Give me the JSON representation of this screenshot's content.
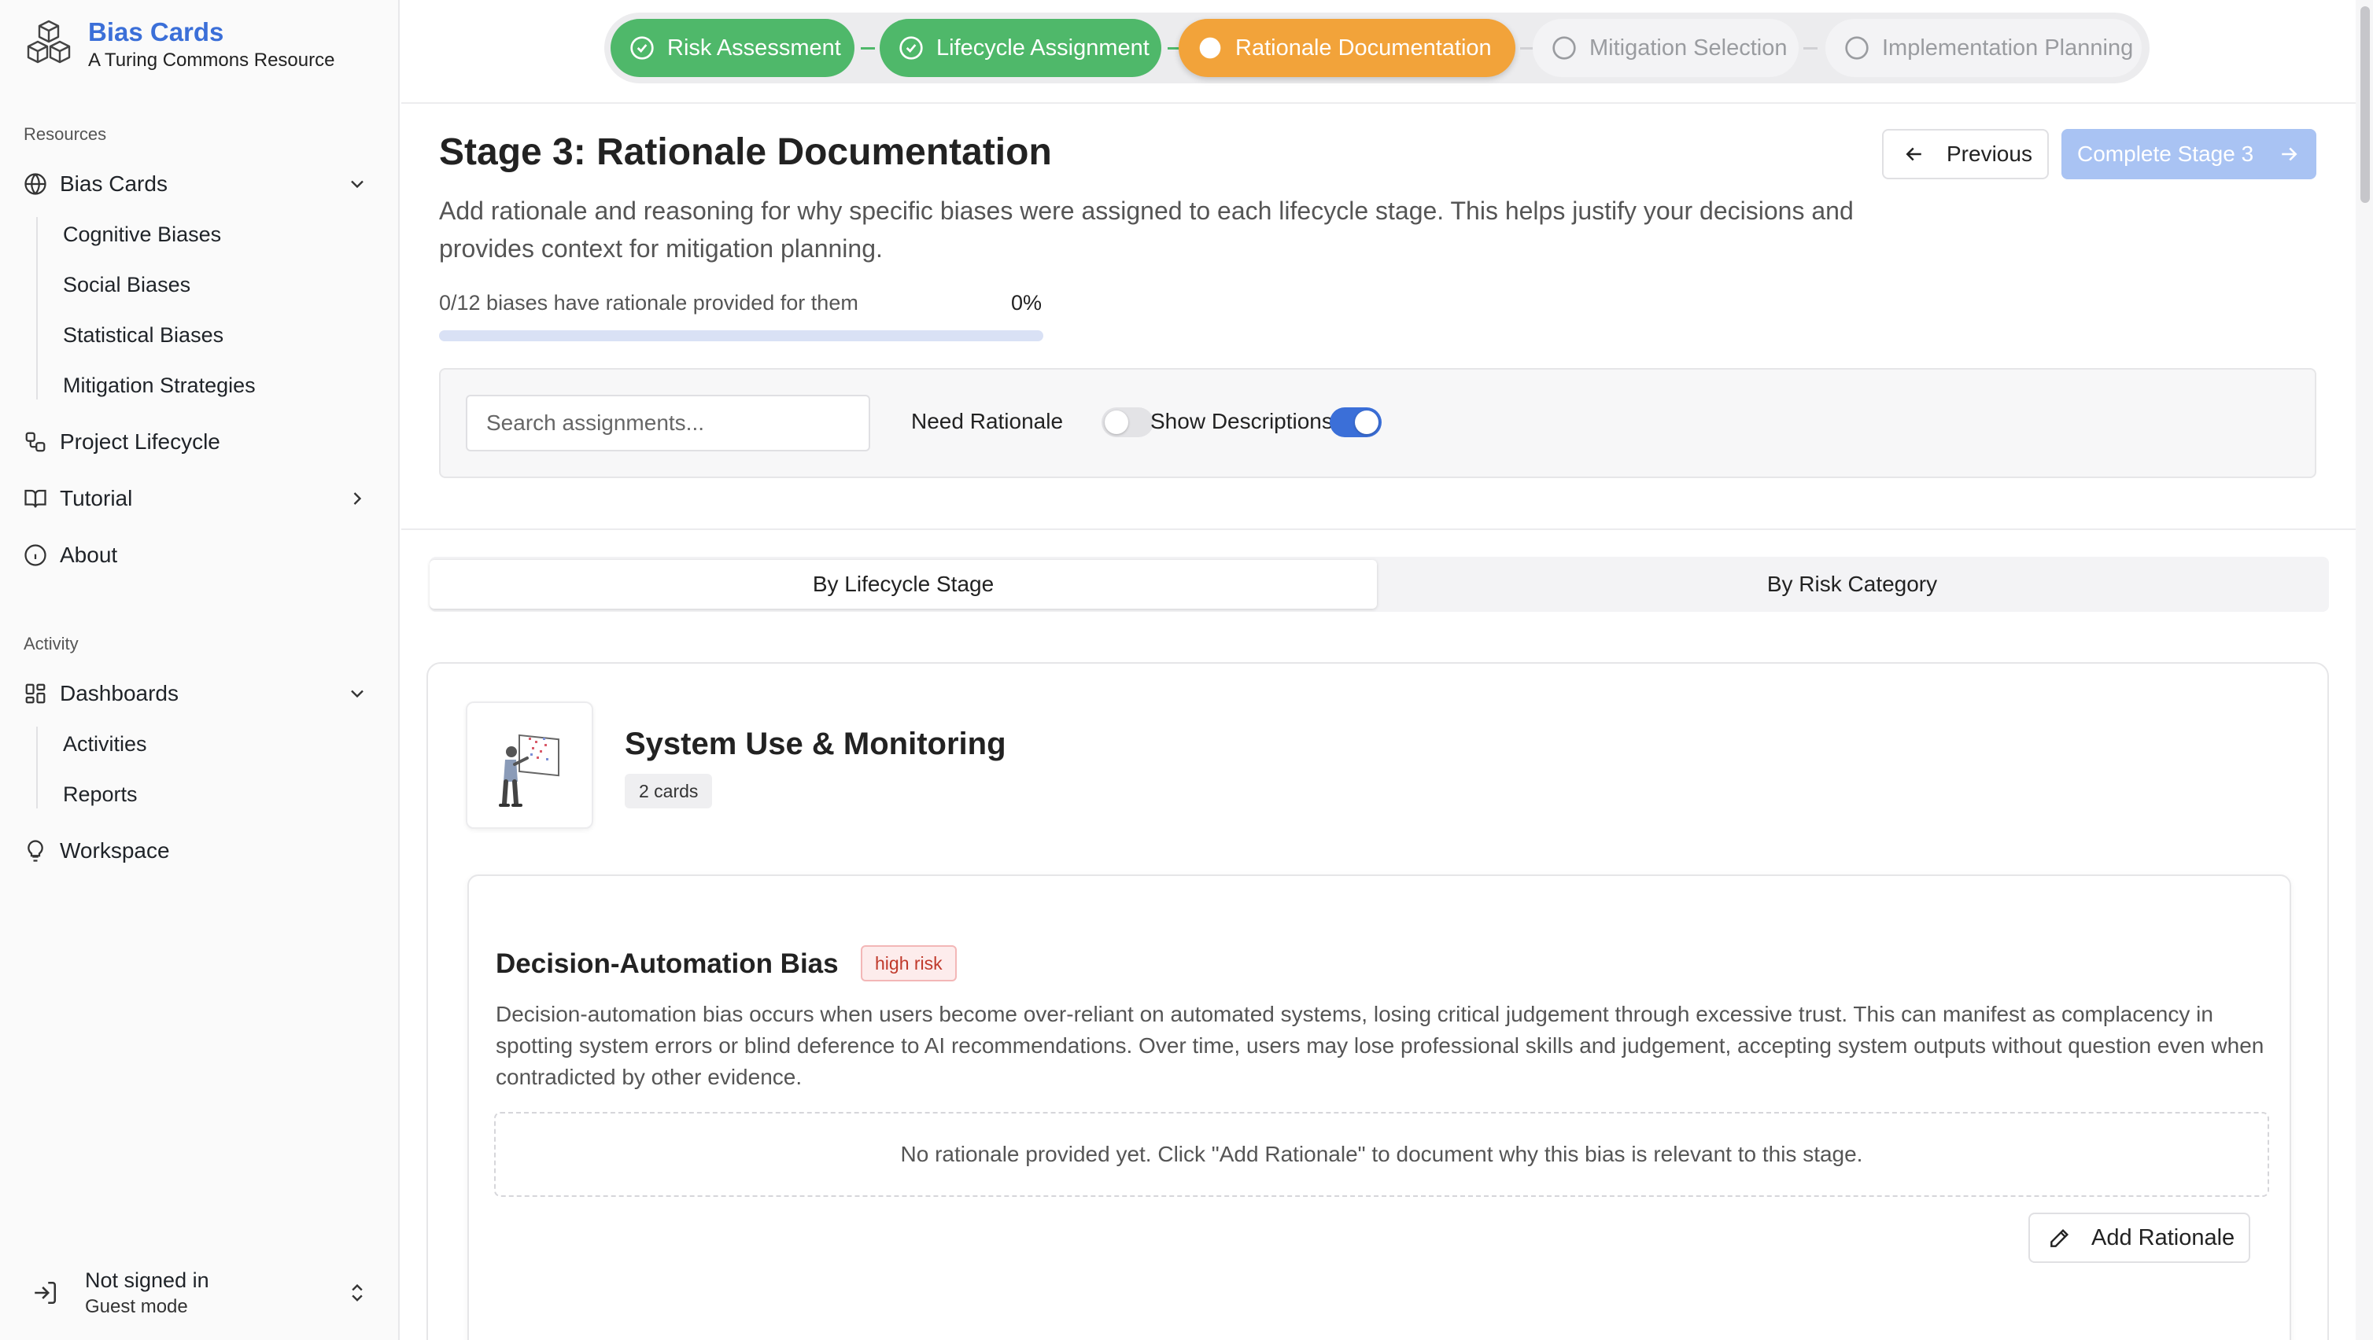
{
  "brand": {
    "title": "Bias Cards",
    "subtitle": "A Turing Commons Resource",
    "logo_icon": "cube-stack-icon"
  },
  "sidebar": {
    "resources_label": "Resources",
    "activity_label": "Activity",
    "items": {
      "bias_cards": {
        "label": "Bias Cards",
        "icon": "globe-icon",
        "expanded": true,
        "children": [
          "Cognitive Biases",
          "Social Biases",
          "Statistical Biases",
          "Mitigation Strategies"
        ]
      },
      "project_lifecycle": {
        "label": "Project Lifecycle",
        "icon": "workflow-icon"
      },
      "tutorial": {
        "label": "Tutorial",
        "icon": "book-icon"
      },
      "about": {
        "label": "About",
        "icon": "info-icon"
      },
      "dashboards": {
        "label": "Dashboards",
        "icon": "grid-icon",
        "expanded": true,
        "children": [
          "Activities",
          "Reports"
        ]
      },
      "workspace": {
        "label": "Workspace",
        "icon": "lightbulb-icon"
      }
    },
    "user": {
      "name": "Not signed in",
      "mode": "Guest mode",
      "icon": "sign-in-icon"
    }
  },
  "stepper": {
    "steps": [
      {
        "label": "Risk Assessment",
        "status": "done"
      },
      {
        "label": "Lifecycle Assignment",
        "status": "done"
      },
      {
        "label": "Rationale Documentation",
        "status": "active"
      },
      {
        "label": "Mitigation Selection",
        "status": "todo"
      },
      {
        "label": "Implementation Planning",
        "status": "todo"
      }
    ],
    "colors": {
      "done": "#4fb86a",
      "active": "#f2a33a",
      "todo": "#f3f3f5"
    }
  },
  "header": {
    "title": "Stage 3: Rationale Documentation",
    "description": "Add rationale and reasoning for why specific biases were assigned to each lifecycle stage. This helps justify your decisions and provides context for mitigation planning.",
    "previous_label": "Previous",
    "complete_label": "Complete Stage 3"
  },
  "progress": {
    "text": "0/12 biases have rationale provided for them",
    "percent_label": "0%",
    "fraction": 0
  },
  "filters": {
    "search_placeholder": "Search assignments...",
    "search_value": "",
    "need_rationale_label": "Need Rationale",
    "need_rationale_on": false,
    "show_descriptions_label": "Show Descriptions",
    "show_descriptions_on": true
  },
  "tabs": [
    {
      "label": "By Lifecycle Stage",
      "selected": true
    },
    {
      "label": "By Risk Category",
      "selected": false
    }
  ],
  "stage": {
    "name": "System Use & Monitoring",
    "count": "2 cards",
    "illustration": "person-monitoring-screen-illustration",
    "bias": {
      "name": "Decision-Automation Bias",
      "risk": "high risk",
      "description": "Decision-automation bias occurs when users become over-reliant on automated systems, losing critical judgement through excessive trust. This can manifest as complacency in spotting system errors or blind deference to AI recommendations. Over time, users may lose professional skills and judgement, accepting system outputs without question even when contradicted by other evidence.",
      "empty_rationale": "No rationale provided yet. Click \"Add Rationale\" to document why this bias is relevant to this stage.",
      "add_label": "Add Rationale"
    }
  },
  "accent_color": "#3b6fd8"
}
